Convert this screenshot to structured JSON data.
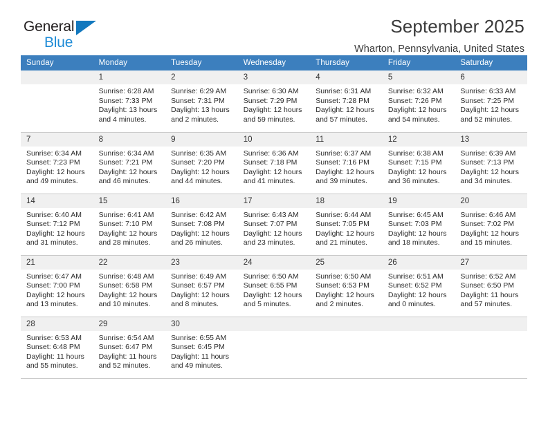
{
  "brand": {
    "name_top": "General",
    "name_bottom": "Blue",
    "triangle_color": "#1278be",
    "text_color": "#231f20",
    "accent_color": "#1e8bd6"
  },
  "header": {
    "title": "September 2025",
    "subtitle": "Wharton, Pennsylvania, United States"
  },
  "theme": {
    "header_bg": "#3c7fbe",
    "header_fg": "#ffffff",
    "daynum_bg": "#f0f0f0",
    "grid_line": "#c9c9c9"
  },
  "weekdays": [
    "Sunday",
    "Monday",
    "Tuesday",
    "Wednesday",
    "Thursday",
    "Friday",
    "Saturday"
  ],
  "labels": {
    "sunrise_prefix": "Sunrise:",
    "sunset_prefix": "Sunset:",
    "daylight_prefix": "Daylight:"
  },
  "weeks": [
    [
      {
        "day": "",
        "sunrise": "",
        "sunset": "",
        "daylight_line1": "",
        "daylight_line2": ""
      },
      {
        "day": "1",
        "sunrise": "Sunrise: 6:28 AM",
        "sunset": "Sunset: 7:33 PM",
        "daylight_line1": "Daylight: 13 hours",
        "daylight_line2": "and 4 minutes."
      },
      {
        "day": "2",
        "sunrise": "Sunrise: 6:29 AM",
        "sunset": "Sunset: 7:31 PM",
        "daylight_line1": "Daylight: 13 hours",
        "daylight_line2": "and 2 minutes."
      },
      {
        "day": "3",
        "sunrise": "Sunrise: 6:30 AM",
        "sunset": "Sunset: 7:29 PM",
        "daylight_line1": "Daylight: 12 hours",
        "daylight_line2": "and 59 minutes."
      },
      {
        "day": "4",
        "sunrise": "Sunrise: 6:31 AM",
        "sunset": "Sunset: 7:28 PM",
        "daylight_line1": "Daylight: 12 hours",
        "daylight_line2": "and 57 minutes."
      },
      {
        "day": "5",
        "sunrise": "Sunrise: 6:32 AM",
        "sunset": "Sunset: 7:26 PM",
        "daylight_line1": "Daylight: 12 hours",
        "daylight_line2": "and 54 minutes."
      },
      {
        "day": "6",
        "sunrise": "Sunrise: 6:33 AM",
        "sunset": "Sunset: 7:25 PM",
        "daylight_line1": "Daylight: 12 hours",
        "daylight_line2": "and 52 minutes."
      }
    ],
    [
      {
        "day": "7",
        "sunrise": "Sunrise: 6:34 AM",
        "sunset": "Sunset: 7:23 PM",
        "daylight_line1": "Daylight: 12 hours",
        "daylight_line2": "and 49 minutes."
      },
      {
        "day": "8",
        "sunrise": "Sunrise: 6:34 AM",
        "sunset": "Sunset: 7:21 PM",
        "daylight_line1": "Daylight: 12 hours",
        "daylight_line2": "and 46 minutes."
      },
      {
        "day": "9",
        "sunrise": "Sunrise: 6:35 AM",
        "sunset": "Sunset: 7:20 PM",
        "daylight_line1": "Daylight: 12 hours",
        "daylight_line2": "and 44 minutes."
      },
      {
        "day": "10",
        "sunrise": "Sunrise: 6:36 AM",
        "sunset": "Sunset: 7:18 PM",
        "daylight_line1": "Daylight: 12 hours",
        "daylight_line2": "and 41 minutes."
      },
      {
        "day": "11",
        "sunrise": "Sunrise: 6:37 AM",
        "sunset": "Sunset: 7:16 PM",
        "daylight_line1": "Daylight: 12 hours",
        "daylight_line2": "and 39 minutes."
      },
      {
        "day": "12",
        "sunrise": "Sunrise: 6:38 AM",
        "sunset": "Sunset: 7:15 PM",
        "daylight_line1": "Daylight: 12 hours",
        "daylight_line2": "and 36 minutes."
      },
      {
        "day": "13",
        "sunrise": "Sunrise: 6:39 AM",
        "sunset": "Sunset: 7:13 PM",
        "daylight_line1": "Daylight: 12 hours",
        "daylight_line2": "and 34 minutes."
      }
    ],
    [
      {
        "day": "14",
        "sunrise": "Sunrise: 6:40 AM",
        "sunset": "Sunset: 7:12 PM",
        "daylight_line1": "Daylight: 12 hours",
        "daylight_line2": "and 31 minutes."
      },
      {
        "day": "15",
        "sunrise": "Sunrise: 6:41 AM",
        "sunset": "Sunset: 7:10 PM",
        "daylight_line1": "Daylight: 12 hours",
        "daylight_line2": "and 28 minutes."
      },
      {
        "day": "16",
        "sunrise": "Sunrise: 6:42 AM",
        "sunset": "Sunset: 7:08 PM",
        "daylight_line1": "Daylight: 12 hours",
        "daylight_line2": "and 26 minutes."
      },
      {
        "day": "17",
        "sunrise": "Sunrise: 6:43 AM",
        "sunset": "Sunset: 7:07 PM",
        "daylight_line1": "Daylight: 12 hours",
        "daylight_line2": "and 23 minutes."
      },
      {
        "day": "18",
        "sunrise": "Sunrise: 6:44 AM",
        "sunset": "Sunset: 7:05 PM",
        "daylight_line1": "Daylight: 12 hours",
        "daylight_line2": "and 21 minutes."
      },
      {
        "day": "19",
        "sunrise": "Sunrise: 6:45 AM",
        "sunset": "Sunset: 7:03 PM",
        "daylight_line1": "Daylight: 12 hours",
        "daylight_line2": "and 18 minutes."
      },
      {
        "day": "20",
        "sunrise": "Sunrise: 6:46 AM",
        "sunset": "Sunset: 7:02 PM",
        "daylight_line1": "Daylight: 12 hours",
        "daylight_line2": "and 15 minutes."
      }
    ],
    [
      {
        "day": "21",
        "sunrise": "Sunrise: 6:47 AM",
        "sunset": "Sunset: 7:00 PM",
        "daylight_line1": "Daylight: 12 hours",
        "daylight_line2": "and 13 minutes."
      },
      {
        "day": "22",
        "sunrise": "Sunrise: 6:48 AM",
        "sunset": "Sunset: 6:58 PM",
        "daylight_line1": "Daylight: 12 hours",
        "daylight_line2": "and 10 minutes."
      },
      {
        "day": "23",
        "sunrise": "Sunrise: 6:49 AM",
        "sunset": "Sunset: 6:57 PM",
        "daylight_line1": "Daylight: 12 hours",
        "daylight_line2": "and 8 minutes."
      },
      {
        "day": "24",
        "sunrise": "Sunrise: 6:50 AM",
        "sunset": "Sunset: 6:55 PM",
        "daylight_line1": "Daylight: 12 hours",
        "daylight_line2": "and 5 minutes."
      },
      {
        "day": "25",
        "sunrise": "Sunrise: 6:50 AM",
        "sunset": "Sunset: 6:53 PM",
        "daylight_line1": "Daylight: 12 hours",
        "daylight_line2": "and 2 minutes."
      },
      {
        "day": "26",
        "sunrise": "Sunrise: 6:51 AM",
        "sunset": "Sunset: 6:52 PM",
        "daylight_line1": "Daylight: 12 hours",
        "daylight_line2": "and 0 minutes."
      },
      {
        "day": "27",
        "sunrise": "Sunrise: 6:52 AM",
        "sunset": "Sunset: 6:50 PM",
        "daylight_line1": "Daylight: 11 hours",
        "daylight_line2": "and 57 minutes."
      }
    ],
    [
      {
        "day": "28",
        "sunrise": "Sunrise: 6:53 AM",
        "sunset": "Sunset: 6:48 PM",
        "daylight_line1": "Daylight: 11 hours",
        "daylight_line2": "and 55 minutes."
      },
      {
        "day": "29",
        "sunrise": "Sunrise: 6:54 AM",
        "sunset": "Sunset: 6:47 PM",
        "daylight_line1": "Daylight: 11 hours",
        "daylight_line2": "and 52 minutes."
      },
      {
        "day": "30",
        "sunrise": "Sunrise: 6:55 AM",
        "sunset": "Sunset: 6:45 PM",
        "daylight_line1": "Daylight: 11 hours",
        "daylight_line2": "and 49 minutes."
      },
      {
        "day": "",
        "sunrise": "",
        "sunset": "",
        "daylight_line1": "",
        "daylight_line2": ""
      },
      {
        "day": "",
        "sunrise": "",
        "sunset": "",
        "daylight_line1": "",
        "daylight_line2": ""
      },
      {
        "day": "",
        "sunrise": "",
        "sunset": "",
        "daylight_line1": "",
        "daylight_line2": ""
      },
      {
        "day": "",
        "sunrise": "",
        "sunset": "",
        "daylight_line1": "",
        "daylight_line2": ""
      }
    ]
  ]
}
